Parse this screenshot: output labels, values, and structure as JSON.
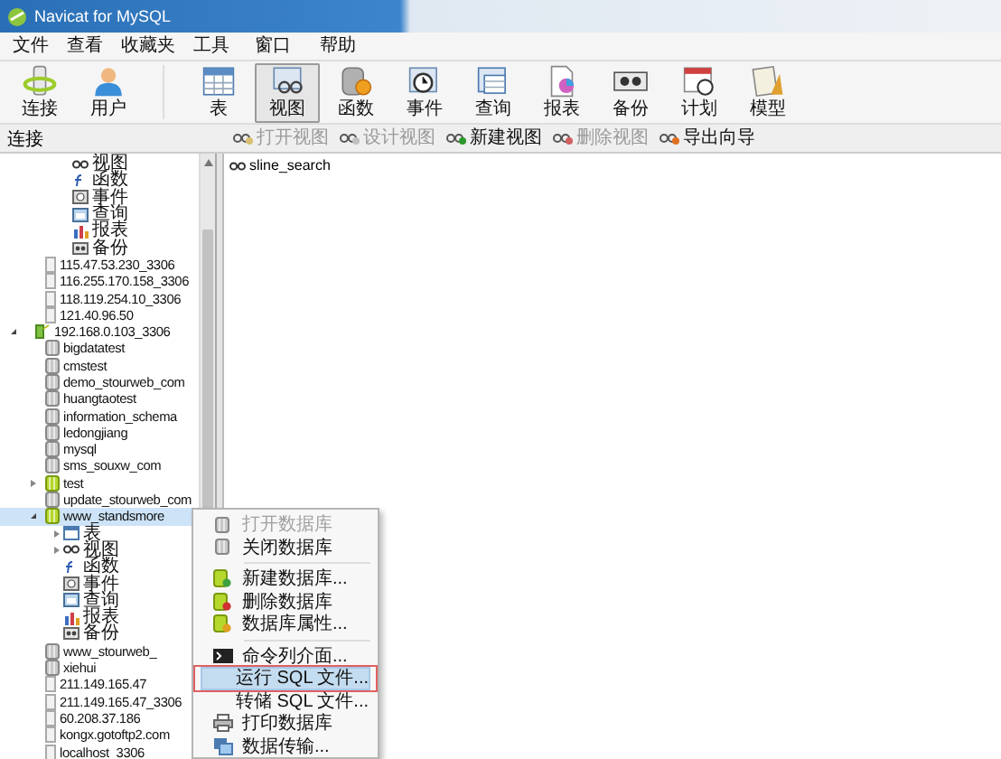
{
  "window": {
    "title": "Navicat for MySQL"
  },
  "menu": [
    "文件",
    "查看",
    "收藏夹",
    "工具",
    "窗口",
    "帮助"
  ],
  "toolbar": [
    {
      "label": "连接",
      "selected": false
    },
    {
      "label": "用户",
      "selected": false
    },
    {
      "label": "表",
      "selected": false
    },
    {
      "label": "视图",
      "selected": true
    },
    {
      "label": "函数",
      "selected": false
    },
    {
      "label": "事件",
      "selected": false
    },
    {
      "label": "查询",
      "selected": false
    },
    {
      "label": "报表",
      "selected": false
    },
    {
      "label": "备份",
      "selected": false
    },
    {
      "label": "计划",
      "selected": false
    },
    {
      "label": "模型",
      "selected": false
    }
  ],
  "connections_header": "连接",
  "object_toolbar": [
    {
      "label": "打开视图",
      "disabled": true
    },
    {
      "label": "设计视图",
      "disabled": true
    },
    {
      "label": "新建视图",
      "disabled": false
    },
    {
      "label": "删除视图",
      "disabled": true
    },
    {
      "label": "导出向导",
      "disabled": false
    }
  ],
  "tree_scrolled_objects": [
    {
      "kind": "view",
      "label": "视图"
    },
    {
      "kind": "function",
      "label": "函数"
    },
    {
      "kind": "event",
      "label": "事件"
    },
    {
      "kind": "query",
      "label": "查询"
    },
    {
      "kind": "report",
      "label": "报表"
    },
    {
      "kind": "backup",
      "label": "备份"
    }
  ],
  "connections": [
    {
      "label": "115.47.53.230_3306",
      "connected": false
    },
    {
      "label": "116.255.170.158_3306",
      "connected": false
    },
    {
      "label": "118.119.254.10_3306",
      "connected": false
    },
    {
      "label": "121.40.96.50",
      "connected": false
    },
    {
      "label": "192.168.0.103_3306",
      "connected": true,
      "expanded": true,
      "children": [
        {
          "label": "bigdatatest",
          "open": false
        },
        {
          "label": "cmstest",
          "open": false
        },
        {
          "label": "demo_stourweb_com",
          "open": false
        },
        {
          "label": "huangtaotest",
          "open": false
        },
        {
          "label": "information_schema",
          "open": false
        },
        {
          "label": "ledongjiang",
          "open": false
        },
        {
          "label": "mysql",
          "open": false
        },
        {
          "label": "sms_souxw_com",
          "open": false
        },
        {
          "label": "test",
          "open": true,
          "expanded": false
        },
        {
          "label": "update_stourweb_com",
          "open": false
        },
        {
          "label": "www_standsmore",
          "open": true,
          "expanded": true,
          "selected": true,
          "children": [
            {
              "kind": "table",
              "label": "表",
              "expanded": false
            },
            {
              "kind": "view",
              "label": "视图",
              "expanded": false
            },
            {
              "kind": "function",
              "label": "函数"
            },
            {
              "kind": "event",
              "label": "事件"
            },
            {
              "kind": "query",
              "label": "查询"
            },
            {
              "kind": "report",
              "label": "报表"
            },
            {
              "kind": "backup",
              "label": "备份"
            }
          ]
        },
        {
          "label": "www_stourweb_",
          "open": false
        },
        {
          "label": "xiehui",
          "open": false
        }
      ]
    },
    {
      "label": "211.149.165.47",
      "connected": false
    },
    {
      "label": "211.149.165.47_3306",
      "connected": false
    },
    {
      "label": "60.208.37.186",
      "connected": false
    },
    {
      "label": "kongx.gotoftp2.com",
      "connected": false
    },
    {
      "label": "localhost_3306",
      "connected": false
    }
  ],
  "objects": [
    {
      "label": "sline_search"
    }
  ],
  "context_menu": [
    {
      "label": "打开数据库",
      "disabled": true,
      "highlighted": false,
      "outlined": false,
      "separator_before": false
    },
    {
      "label": "关闭数据库",
      "disabled": false,
      "highlighted": false,
      "outlined": false,
      "separator_before": false
    },
    {
      "label": "新建数据库...",
      "disabled": false,
      "highlighted": false,
      "outlined": false,
      "separator_before": true
    },
    {
      "label": "删除数据库",
      "disabled": false,
      "highlighted": false,
      "outlined": false,
      "separator_before": false
    },
    {
      "label": "数据库属性...",
      "disabled": false,
      "highlighted": false,
      "outlined": false,
      "separator_before": false
    },
    {
      "label": "命令列介面...",
      "disabled": false,
      "highlighted": false,
      "outlined": false,
      "separator_before": true
    },
    {
      "label": "运行 SQL 文件...",
      "disabled": false,
      "highlighted": true,
      "outlined": true,
      "separator_before": false
    },
    {
      "label": "转储 SQL 文件...",
      "disabled": false,
      "highlighted": false,
      "outlined": false,
      "separator_before": false
    },
    {
      "label": "打印数据库",
      "disabled": false,
      "highlighted": false,
      "outlined": false,
      "separator_before": false
    },
    {
      "label": "数据传输...",
      "disabled": false,
      "highlighted": false,
      "outlined": false,
      "separator_before": false
    }
  ]
}
